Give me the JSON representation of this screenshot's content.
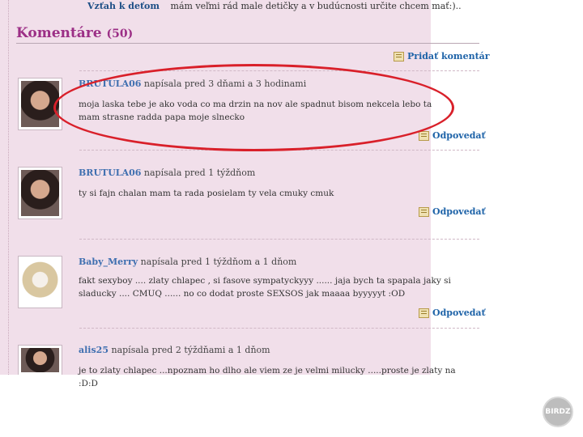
{
  "top": {
    "label": "Vzťah k deťom",
    "value": "mám veľmi rád male detičky a v budúcnosti určite chcem mať:).."
  },
  "comments_header": {
    "title": "Komentáre",
    "count": "(50)"
  },
  "add_comment": {
    "label": "Pridať komentár",
    "icon": "note-icon"
  },
  "reply_label": "Odpovedať",
  "comments": [
    {
      "author": "BRUTULA06",
      "meta": "napísala pred 3 dňami a 3 hodinami",
      "text": "moja laska tebe je ako voda co ma drzin na nov ale spadnut bisom nekcela lebo ta mam strasne radda papa moje slnecko"
    },
    {
      "author": "BRUTULA06",
      "meta": "napísala pred 1 týždňom",
      "text": "ty si fajn chalan mam ta rada posielam ty vela cmuky cmuk"
    },
    {
      "author": "Baby_Merry",
      "meta": "napísala pred 1 týždňom a 1 dňom",
      "text": "fakt sexyboy .... zlaty chlapec , si fasove sympatyckyyy ...... jaja bych ta spapala jaky si sladucky .... CMUQ ...... no co dodat proste SEXSOS jak maaaa byyyyyt :OD"
    },
    {
      "author": "alis25",
      "meta": "napísala pred 2 týždňami a 1 dňom",
      "text": "je to zlaty chlapec ...npoznam ho dlho ale viem ze je velmi milucky .....proste je zlaty na :D:D"
    }
  ],
  "watermark": "BIRDZ",
  "colors": {
    "panel": "#f1dfea",
    "title": "#9c2f86",
    "link": "#1e63a8",
    "highlight": "#d9202a"
  }
}
